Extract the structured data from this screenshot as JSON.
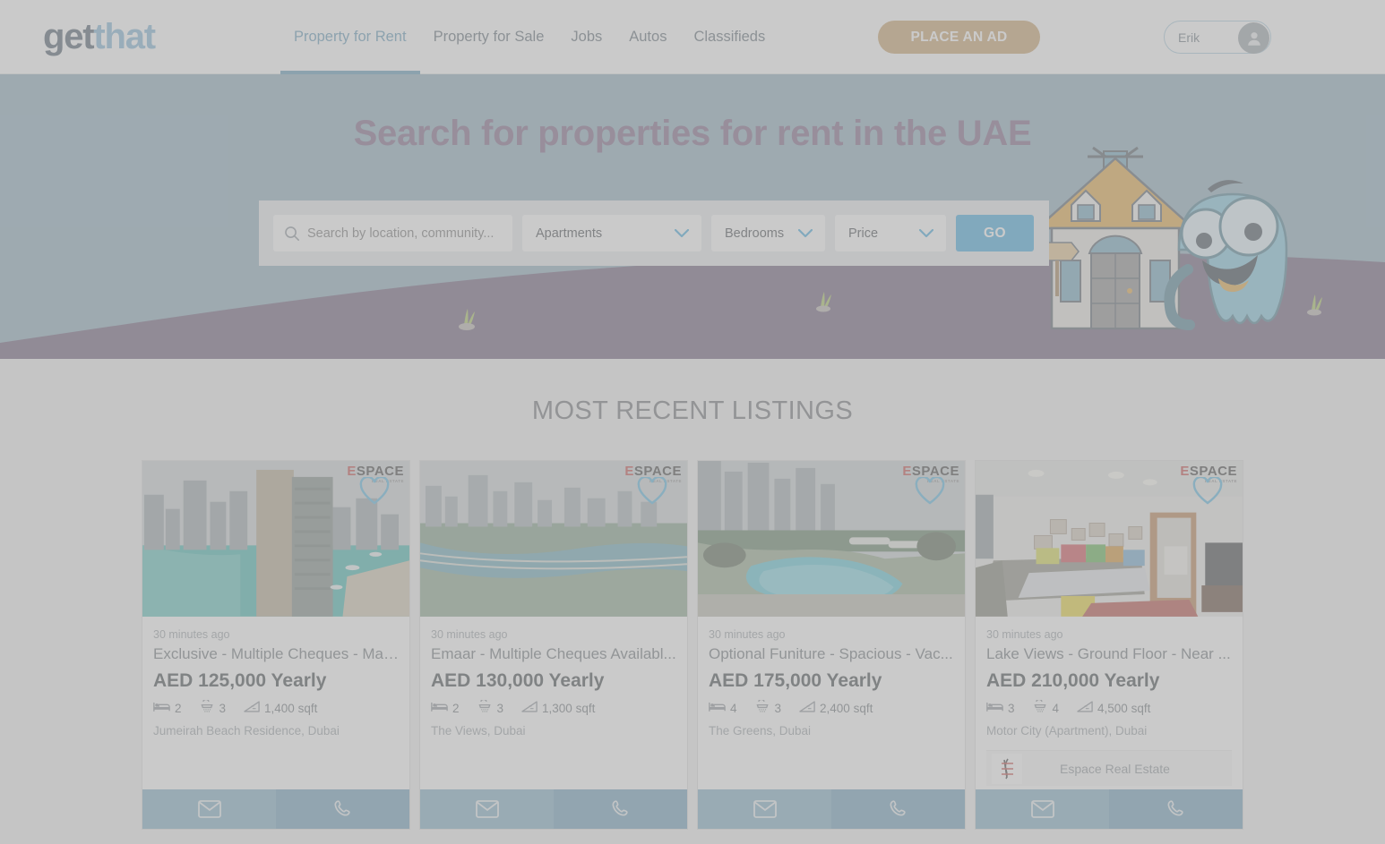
{
  "header": {
    "logo": {
      "part1": "get",
      "part2": "that"
    },
    "nav": [
      {
        "label": "Property for Rent",
        "active": true
      },
      {
        "label": "Property for Sale",
        "active": false
      },
      {
        "label": "Jobs",
        "active": false
      },
      {
        "label": "Autos",
        "active": false
      },
      {
        "label": "Classifieds",
        "active": false
      }
    ],
    "place_ad_label": "PLACE AN AD",
    "user_name": "Erik"
  },
  "hero": {
    "title": "Search for properties for rent in the UAE",
    "search": {
      "placeholder": "Search by location, community...",
      "value": "",
      "property_type": "Apartments",
      "bedrooms": "Bedrooms",
      "price": "Price",
      "go_label": "GO"
    }
  },
  "listings": {
    "section_title": "MOST RECENT LISTINGS",
    "cards": [
      {
        "time_ago": "30 minutes ago",
        "title": "Exclusive - Multiple Cheques - Mar...",
        "price": "AED 125,000 Yearly",
        "beds": "2",
        "baths": "3",
        "area": "1,400 sqft",
        "location": "Jumeirah Beach Residence, Dubai",
        "watermark": "SPACE",
        "watermark_sub": "REAL ESTATE",
        "agency": ""
      },
      {
        "time_ago": "30 minutes ago",
        "title": "Emaar - Multiple Cheques Availabl...",
        "price": "AED 130,000 Yearly",
        "beds": "2",
        "baths": "3",
        "area": "1,300 sqft",
        "location": "The Views, Dubai",
        "watermark": "SPACE",
        "watermark_sub": "REAL ESTATE",
        "agency": ""
      },
      {
        "time_ago": "30 minutes ago",
        "title": "Optional Funiture - Spacious - Vac...",
        "price": "AED 175,000 Yearly",
        "beds": "4",
        "baths": "3",
        "area": "2,400 sqft",
        "location": "The Greens, Dubai",
        "watermark": "SPACE",
        "watermark_sub": "REAL ESTATE",
        "agency": ""
      },
      {
        "time_ago": "30 minutes ago",
        "title": "Lake Views - Ground Floor - Near ...",
        "price": "AED 210,000 Yearly",
        "beds": "3",
        "baths": "4",
        "area": "4,500 sqft",
        "location": "Motor City (Apartment), Dubai",
        "watermark": "SPACE",
        "watermark_sub": "REAL ESTATE",
        "agency": "Espace Real Estate"
      }
    ]
  },
  "colors": {
    "brand_blue": "#7fb4d4",
    "accent_blue": "#40a9dd",
    "place_ad_gold": "#c8a06b",
    "hero_sky": "#8babbc",
    "hero_hill": "#6b5b78",
    "hero_title": "#7b6384",
    "action_mail": "#7faec6",
    "action_phone": "#6d9fba"
  }
}
